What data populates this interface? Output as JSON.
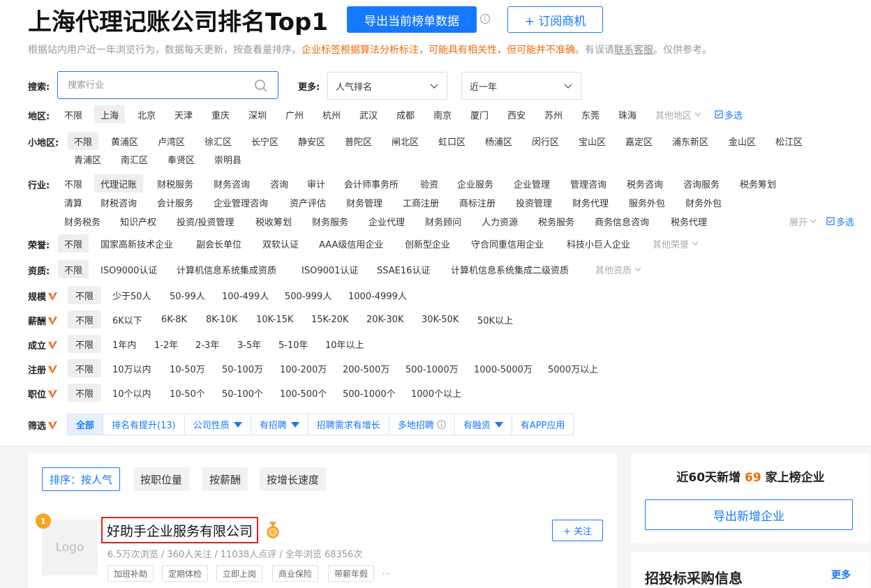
{
  "header": {
    "title": "上海代理记账公司排名Top1",
    "export_label": "导出当前榜单数据",
    "subscribe_label": "+ 订阅商机",
    "info_glyph": "i",
    "subtitle_prefix": "根据站内用户近一年浏览行为，数据每天更新，按查看量排序。",
    "subtitle_warning": "企业标签根据算法分析标注，可能具有相关性，但可能并不准确。",
    "subtitle_mid": "有误请",
    "subtitle_link": "联系客服",
    "subtitle_suffix": "。仅供参考。"
  },
  "search": {
    "label": "搜索:",
    "placeholder": "搜索行业",
    "more_label": "更多:",
    "sort_select": "人气排名",
    "period_select": "近一年"
  },
  "region": {
    "label": "地区:",
    "items": [
      "不限",
      "上海",
      "北京",
      "天津",
      "重庆",
      "深圳",
      "广州",
      "杭州",
      "武汉",
      "成都",
      "南京",
      "厦门",
      "西安",
      "苏州",
      "东莞",
      "珠海"
    ],
    "other": "其他地区",
    "multi": "多选"
  },
  "subregion": {
    "label": "小地区:",
    "row1": [
      "不限",
      "黄浦区",
      "卢湾区",
      "徐汇区",
      "长宁区",
      "静安区",
      "普陀区",
      "闸北区",
      "虹口区",
      "杨浦区",
      "闵行区",
      "宝山区",
      "嘉定区",
      "浦东新区",
      "金山区",
      "松江区"
    ],
    "row2": [
      "青浦区",
      "南汇区",
      "奉贤区",
      "崇明县"
    ]
  },
  "industry": {
    "label": "行业:",
    "row1": [
      "不限",
      "代理记账",
      "财税服务",
      "财务咨询",
      "咨询",
      "审计",
      "会计师事务所",
      "验资",
      "企业服务",
      "企业管理",
      "管理咨询",
      "税务咨询",
      "咨询服务",
      "税务筹划"
    ],
    "row2": [
      "清算",
      "财税咨询",
      "会计服务",
      "企业管理咨询",
      "资产评估",
      "财务管理",
      "工商注册",
      "商标注册",
      "投资管理",
      "财务代理",
      "服务外包",
      "财务外包"
    ],
    "row3": [
      "财务税务",
      "知识产权",
      "投资/投资管理",
      "税收筹划",
      "财务服务",
      "企业代理",
      "财务顾问",
      "人力资源",
      "税务服务",
      "商务信息咨询",
      "税务代理"
    ],
    "expand": "展开",
    "multi": "多选"
  },
  "honor": {
    "label": "荣誉:",
    "items": [
      "不限",
      "国家高新技术企业",
      "副会长单位",
      "双软认证",
      "AAA级信用企业",
      "创新型企业",
      "守合同重信用企业",
      "科技小巨人企业"
    ],
    "other": "其他荣誉"
  },
  "qualification": {
    "label": "资质:",
    "items": [
      "不限",
      "ISO9000认证",
      "计算机信息系统集成资质",
      "ISO9001认证",
      "SSAE16认证",
      "计算机信息系统集成二级资质"
    ],
    "other": "其他资质"
  },
  "scale": {
    "label": "规模",
    "items": [
      "不限",
      "少于50人",
      "50-99人",
      "100-499人",
      "500-999人",
      "1000-4999人"
    ]
  },
  "salary": {
    "label": "薪酬",
    "items": [
      "不限",
      "6K以下",
      "6K-8K",
      "8K-10K",
      "10K-15K",
      "15K-20K",
      "20K-30K",
      "30K-50K",
      "50K以上"
    ]
  },
  "founded": {
    "label": "成立",
    "items": [
      "不限",
      "1年内",
      "1-2年",
      "2-3年",
      "3-5年",
      "5-10年",
      "10年以上"
    ]
  },
  "capital": {
    "label": "注册",
    "items": [
      "不限",
      "10万以内",
      "10-50万",
      "50-100万",
      "100-200万",
      "200-500万",
      "500-1000万",
      "1000-5000万",
      "5000万以上"
    ]
  },
  "positions": {
    "label": "职位",
    "items": [
      "不限",
      "10个以内",
      "10-50个",
      "50-100个",
      "100-500个",
      "500-1000个",
      "1000个以上"
    ]
  },
  "screen": {
    "label": "筛选",
    "items": [
      "全部",
      "排名有提升(13)",
      "公司性质",
      "有招聘",
      "招聘需求有增长",
      "多地招聘",
      "有融资",
      "有APP应用"
    ]
  },
  "sort": {
    "items": [
      "排序：按人气",
      "按职位量",
      "按薪酬",
      "按增长速度"
    ]
  },
  "company": {
    "rank": "1",
    "logo_text": "Logo",
    "name": "好助手企业服务有限公司",
    "follow_label": "+ 关注",
    "stats": "6.5万次浏览 / 360人关注 / 11038人点评 / 全年浏览 68356次",
    "tags": [
      "加班补助",
      "定期体检",
      "立即上岗",
      "商业保险",
      "带薪年假"
    ],
    "tags_more": "..."
  },
  "sidebar": {
    "new_prefix": "近60天新增",
    "new_count": "69",
    "new_suffix": "家上榜企业",
    "export_new_label": "导出新增企业",
    "bid_title": "招投标采购信息",
    "bid_more": "更多"
  },
  "colors": {
    "primary": "#1677ff",
    "warning": "#f06a0a",
    "badge": "#f5a623",
    "highlight_border": "#e02020"
  }
}
